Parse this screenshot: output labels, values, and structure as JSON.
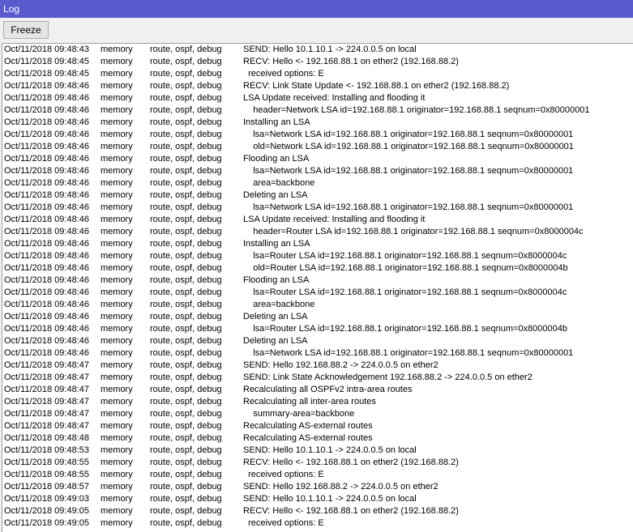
{
  "window": {
    "title": "Log"
  },
  "toolbar": {
    "freeze_label": "Freeze"
  },
  "log": {
    "entries": [
      {
        "time": "Oct/11/2018 09:48:43",
        "buffer": "memory",
        "topics": "route, ospf, debug",
        "message": "SEND: Hello 10.1.10.1 -> 224.0.0.5 on local"
      },
      {
        "time": "Oct/11/2018 09:48:45",
        "buffer": "memory",
        "topics": "route, ospf, debug",
        "message": "RECV: Hello <- 192.168.88.1 on ether2 (192.168.88.2)"
      },
      {
        "time": "Oct/11/2018 09:48:45",
        "buffer": "memory",
        "topics": "route, ospf, debug",
        "message": "  received options: E"
      },
      {
        "time": "Oct/11/2018 09:48:46",
        "buffer": "memory",
        "topics": "route, ospf, debug",
        "message": "RECV: Link State Update <- 192.168.88.1 on ether2 (192.168.88.2)"
      },
      {
        "time": "Oct/11/2018 09:48:46",
        "buffer": "memory",
        "topics": "route, ospf, debug",
        "message": "LSA Update received: Installing and flooding it"
      },
      {
        "time": "Oct/11/2018 09:48:46",
        "buffer": "memory",
        "topics": "route, ospf, debug",
        "message": "    header=Network LSA id=192.168.88.1 originator=192.168.88.1 seqnum=0x80000001"
      },
      {
        "time": "Oct/11/2018 09:48:46",
        "buffer": "memory",
        "topics": "route, ospf, debug",
        "message": "Installing an LSA"
      },
      {
        "time": "Oct/11/2018 09:48:46",
        "buffer": "memory",
        "topics": "route, ospf, debug",
        "message": "    lsa=Network LSA id=192.168.88.1 originator=192.168.88.1 seqnum=0x80000001"
      },
      {
        "time": "Oct/11/2018 09:48:46",
        "buffer": "memory",
        "topics": "route, ospf, debug",
        "message": "    old=Network LSA id=192.168.88.1 originator=192.168.88.1 seqnum=0x80000001"
      },
      {
        "time": "Oct/11/2018 09:48:46",
        "buffer": "memory",
        "topics": "route, ospf, debug",
        "message": "Flooding an LSA"
      },
      {
        "time": "Oct/11/2018 09:48:46",
        "buffer": "memory",
        "topics": "route, ospf, debug",
        "message": "    lsa=Network LSA id=192.168.88.1 originator=192.168.88.1 seqnum=0x80000001"
      },
      {
        "time": "Oct/11/2018 09:48:46",
        "buffer": "memory",
        "topics": "route, ospf, debug",
        "message": "    area=backbone"
      },
      {
        "time": "Oct/11/2018 09:48:46",
        "buffer": "memory",
        "topics": "route, ospf, debug",
        "message": "Deleting an LSA"
      },
      {
        "time": "Oct/11/2018 09:48:46",
        "buffer": "memory",
        "topics": "route, ospf, debug",
        "message": "    lsa=Network LSA id=192.168.88.1 originator=192.168.88.1 seqnum=0x80000001"
      },
      {
        "time": "Oct/11/2018 09:48:46",
        "buffer": "memory",
        "topics": "route, ospf, debug",
        "message": "LSA Update received: Installing and flooding it"
      },
      {
        "time": "Oct/11/2018 09:48:46",
        "buffer": "memory",
        "topics": "route, ospf, debug",
        "message": "    header=Router LSA id=192.168.88.1 originator=192.168.88.1 seqnum=0x8000004c"
      },
      {
        "time": "Oct/11/2018 09:48:46",
        "buffer": "memory",
        "topics": "route, ospf, debug",
        "message": "Installing an LSA"
      },
      {
        "time": "Oct/11/2018 09:48:46",
        "buffer": "memory",
        "topics": "route, ospf, debug",
        "message": "    lsa=Router LSA id=192.168.88.1 originator=192.168.88.1 seqnum=0x8000004c"
      },
      {
        "time": "Oct/11/2018 09:48:46",
        "buffer": "memory",
        "topics": "route, ospf, debug",
        "message": "    old=Router LSA id=192.168.88.1 originator=192.168.88.1 seqnum=0x8000004b"
      },
      {
        "time": "Oct/11/2018 09:48:46",
        "buffer": "memory",
        "topics": "route, ospf, debug",
        "message": "Flooding an LSA"
      },
      {
        "time": "Oct/11/2018 09:48:46",
        "buffer": "memory",
        "topics": "route, ospf, debug",
        "message": "    lsa=Router LSA id=192.168.88.1 originator=192.168.88.1 seqnum=0x8000004c"
      },
      {
        "time": "Oct/11/2018 09:48:46",
        "buffer": "memory",
        "topics": "route, ospf, debug",
        "message": "    area=backbone"
      },
      {
        "time": "Oct/11/2018 09:48:46",
        "buffer": "memory",
        "topics": "route, ospf, debug",
        "message": "Deleting an LSA"
      },
      {
        "time": "Oct/11/2018 09:48:46",
        "buffer": "memory",
        "topics": "route, ospf, debug",
        "message": "    lsa=Router LSA id=192.168.88.1 originator=192.168.88.1 seqnum=0x8000004b"
      },
      {
        "time": "Oct/11/2018 09:48:46",
        "buffer": "memory",
        "topics": "route, ospf, debug",
        "message": "Deleting an LSA"
      },
      {
        "time": "Oct/11/2018 09:48:46",
        "buffer": "memory",
        "topics": "route, ospf, debug",
        "message": "    lsa=Network LSA id=192.168.88.1 originator=192.168.88.1 seqnum=0x80000001"
      },
      {
        "time": "Oct/11/2018 09:48:47",
        "buffer": "memory",
        "topics": "route, ospf, debug",
        "message": "SEND: Hello 192.168.88.2 -> 224.0.0.5 on ether2"
      },
      {
        "time": "Oct/11/2018 09:48:47",
        "buffer": "memory",
        "topics": "route, ospf, debug",
        "message": "SEND: Link State Acknowledgement 192.168.88.2 -> 224.0.0.5 on ether2"
      },
      {
        "time": "Oct/11/2018 09:48:47",
        "buffer": "memory",
        "topics": "route, ospf, debug",
        "message": "Recalculating all OSPFv2 intra-area routes"
      },
      {
        "time": "Oct/11/2018 09:48:47",
        "buffer": "memory",
        "topics": "route, ospf, debug",
        "message": "Recalculating all inter-area routes"
      },
      {
        "time": "Oct/11/2018 09:48:47",
        "buffer": "memory",
        "topics": "route, ospf, debug",
        "message": "    summary-area=backbone"
      },
      {
        "time": "Oct/11/2018 09:48:47",
        "buffer": "memory",
        "topics": "route, ospf, debug",
        "message": "Recalculating AS-external routes"
      },
      {
        "time": "Oct/11/2018 09:48:48",
        "buffer": "memory",
        "topics": "route, ospf, debug",
        "message": "Recalculating AS-external routes"
      },
      {
        "time": "Oct/11/2018 09:48:53",
        "buffer": "memory",
        "topics": "route, ospf, debug",
        "message": "SEND: Hello 10.1.10.1 -> 224.0.0.5 on local"
      },
      {
        "time": "Oct/11/2018 09:48:55",
        "buffer": "memory",
        "topics": "route, ospf, debug",
        "message": "RECV: Hello <- 192.168.88.1 on ether2 (192.168.88.2)"
      },
      {
        "time": "Oct/11/2018 09:48:55",
        "buffer": "memory",
        "topics": "route, ospf, debug",
        "message": "  received options: E"
      },
      {
        "time": "Oct/11/2018 09:48:57",
        "buffer": "memory",
        "topics": "route, ospf, debug",
        "message": "SEND: Hello 192.168.88.2 -> 224.0.0.5 on ether2"
      },
      {
        "time": "Oct/11/2018 09:49:03",
        "buffer": "memory",
        "topics": "route, ospf, debug",
        "message": "SEND: Hello 10.1.10.1 -> 224.0.0.5 on local"
      },
      {
        "time": "Oct/11/2018 09:49:05",
        "buffer": "memory",
        "topics": "route, ospf, debug",
        "message": "RECV: Hello <- 192.168.88.1 on ether2 (192.168.88.2)"
      },
      {
        "time": "Oct/11/2018 09:49:05",
        "buffer": "memory",
        "topics": "route, ospf, debug",
        "message": "  received options: E"
      }
    ]
  }
}
